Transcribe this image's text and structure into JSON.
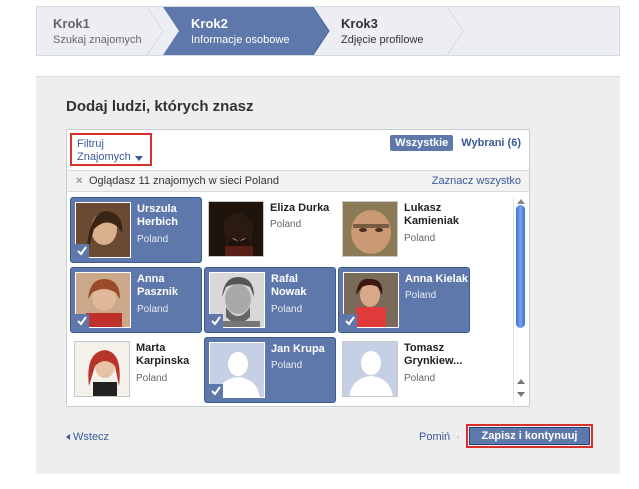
{
  "stepper": {
    "steps": [
      {
        "title": "Krok1",
        "subtitle": "Szukaj znajomych",
        "state": "done"
      },
      {
        "title": "Krok2",
        "subtitle": "Informacje osobowe",
        "state": "active"
      },
      {
        "title": "Krok3",
        "subtitle": "Zdjęcie profilowe",
        "state": "pending"
      }
    ],
    "active_color": "#5f78ab"
  },
  "main": {
    "title": "Dodaj ludzi, których znasz",
    "filter": {
      "label": "Filtruj",
      "value": "Znajomych"
    },
    "tabs": {
      "all": "Wszystkie",
      "selected": "Wybrani (6)"
    },
    "info": {
      "message": "Oglądasz 11 znajomych w sieci Poland",
      "select_all": "Zaznacz wszystko"
    },
    "friends": [
      {
        "first": "Urszula",
        "last": "Herbich",
        "network": "Poland",
        "selected": true
      },
      {
        "first": "Eliza Durka",
        "last": "",
        "network": "Poland",
        "selected": false
      },
      {
        "first": "Lukasz",
        "last": "Kamieniak",
        "network": "Poland",
        "selected": false
      },
      {
        "first": "Anna",
        "last": "Pasznik",
        "network": "Poland",
        "selected": true
      },
      {
        "first": "Rafal",
        "last": "Nowak",
        "network": "Poland",
        "selected": true
      },
      {
        "first": "Anna Kielak",
        "last": "",
        "network": "Poland",
        "selected": true
      },
      {
        "first": "Marta",
        "last": "Karpinska",
        "network": "Poland",
        "selected": false
      },
      {
        "first": "Jan Krupa",
        "last": "",
        "network": "Poland",
        "selected": true
      },
      {
        "first": "Tomasz",
        "last": "Grynkiew...",
        "network": "Poland",
        "selected": false
      }
    ]
  },
  "footer": {
    "back": "Wstecz",
    "skip": "Pomiń",
    "separator": "·",
    "save": "Zapisz i kontynuuj"
  },
  "colors": {
    "fb_blue": "#3b5998",
    "selected_card": "#5f78ab",
    "highlight_red": "#d8302b"
  }
}
